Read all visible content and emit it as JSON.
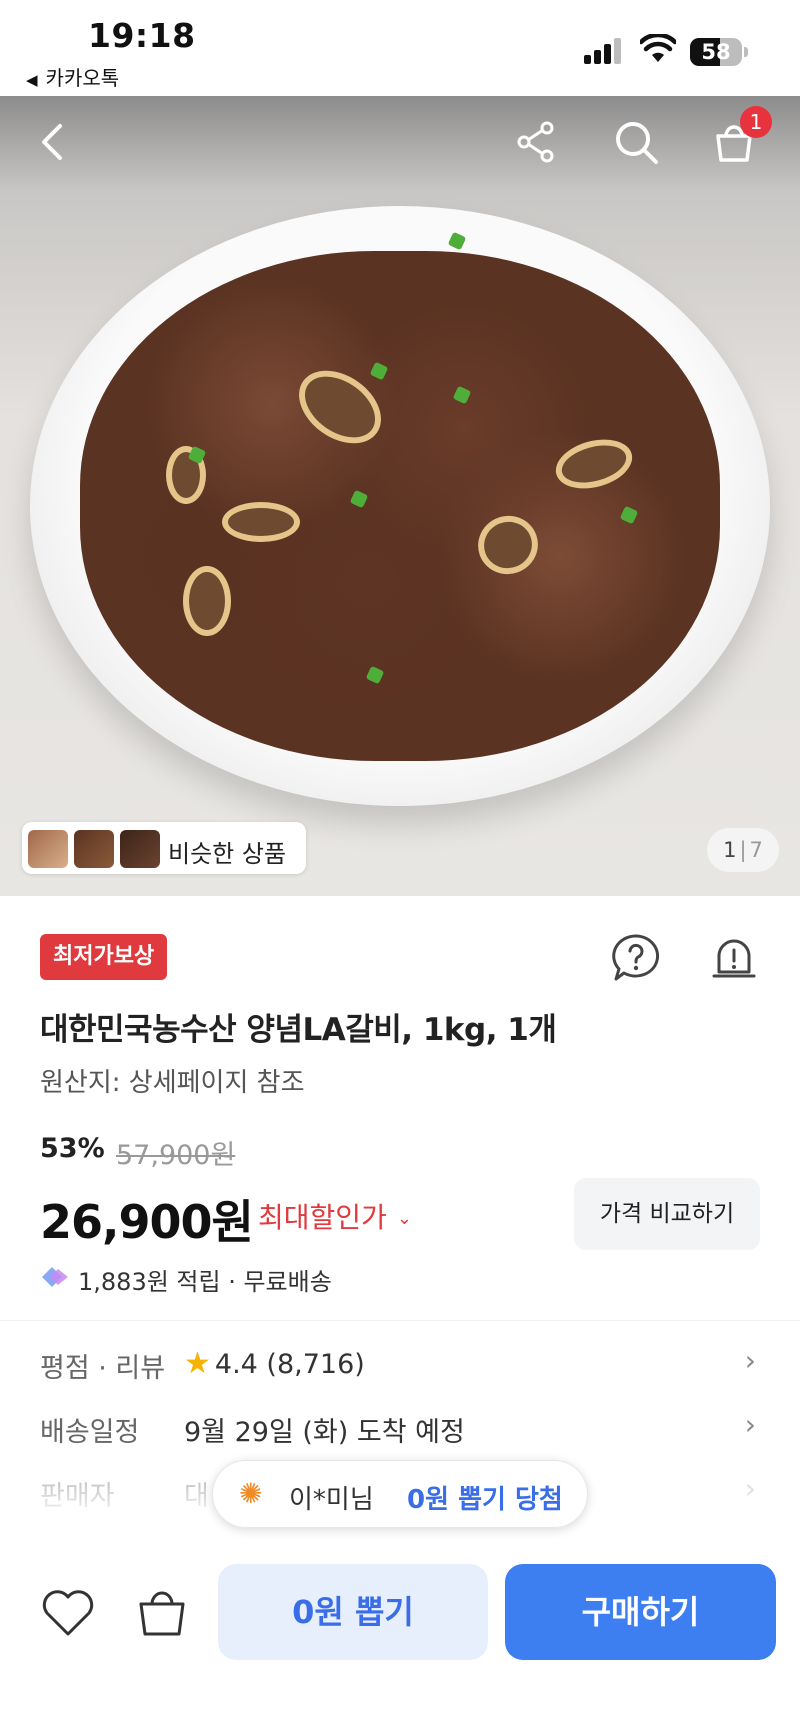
{
  "status_bar": {
    "time": "19:18",
    "back_app": "카카오톡",
    "battery": "58",
    "battery_level": 0.58
  },
  "nav": {
    "cart_count": "1",
    "icons": [
      "back-arrow-icon",
      "share-icon",
      "search-icon",
      "cart-icon"
    ]
  },
  "gallery": {
    "similar_label": "비슷한 상품",
    "current": "1",
    "separator": "|",
    "total": "7"
  },
  "product": {
    "badge": "최저가보상",
    "title": "대한민국농수산 양념LA갈비, 1kg, 1개",
    "origin": "원산지: 상세페이지 참조",
    "discount": "53%",
    "original_price": "57,900원",
    "price": "26,900원",
    "max_discount_label": "최대할인가",
    "compare_button": "가격 비교하기",
    "points": "1,883원 적립 · 무료배송"
  },
  "info_rows": [
    {
      "key": "평점 · 리뷰",
      "value": "4.4 (8,716)"
    },
    {
      "key": "배송일정",
      "value": "9월 29일 (화) 도착 예정"
    },
    {
      "key": "판매자",
      "value": "대"
    }
  ],
  "toast": {
    "user": "이*미님",
    "message": "0원 뽑기 당첨"
  },
  "bottom_bar": {
    "draw_button": "0원 뽑기",
    "buy_button": "구매하기"
  },
  "colors": {
    "accent_blue": "#3d7ff0",
    "discount_red": "#e03a3e",
    "star": "#f5b400"
  }
}
